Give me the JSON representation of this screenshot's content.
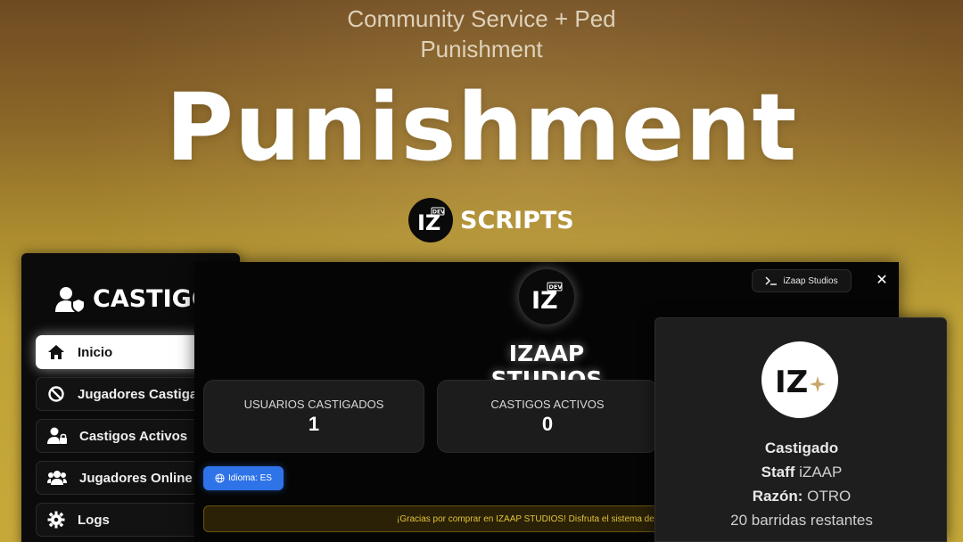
{
  "banner": {
    "subtitle_line1": "Community Service + Ped",
    "subtitle_line2": "Punishment",
    "title": "Punishment",
    "brand_text": "SCRIPTS",
    "brand_logo_badge": "DEV"
  },
  "sidebar": {
    "header": "CASTIGOS",
    "items": [
      {
        "label": "Inicio",
        "icon": "home-icon",
        "active": true
      },
      {
        "label": "Jugadores Castigados",
        "icon": "ban-icon",
        "active": false
      },
      {
        "label": "Castigos Activos",
        "icon": "user-lock-icon",
        "active": false
      },
      {
        "label": "Jugadores Online",
        "icon": "users-icon",
        "active": false
      },
      {
        "label": "Logs",
        "icon": "gear-icon",
        "active": false
      }
    ]
  },
  "panel": {
    "logo_badge": "DEV",
    "studio_button": "iZaap Studios",
    "close_label": "✕",
    "title": "IZAAP STUDIOS",
    "stats": [
      {
        "label": "USUARIOS CASTIGADOS",
        "value": "1"
      },
      {
        "label": "CASTIGOS ACTIVOS",
        "value": "0"
      }
    ],
    "language_button": "Idioma: ES",
    "thanks_text": "¡Gracias por comprar en IZAAP STUDIOS! Disfruta el sistema de castigos"
  },
  "status_card": {
    "status": "Castigado",
    "staff_label": "Staff",
    "staff_value": "iZAAP",
    "reason_label": "Razón:",
    "reason_value": "OTRO",
    "remaining": "20 barridas restantes"
  },
  "colors": {
    "accent_blue": "#2f73e8",
    "notice_yellow": "#e3c33a",
    "panel_bg": "#050505"
  }
}
